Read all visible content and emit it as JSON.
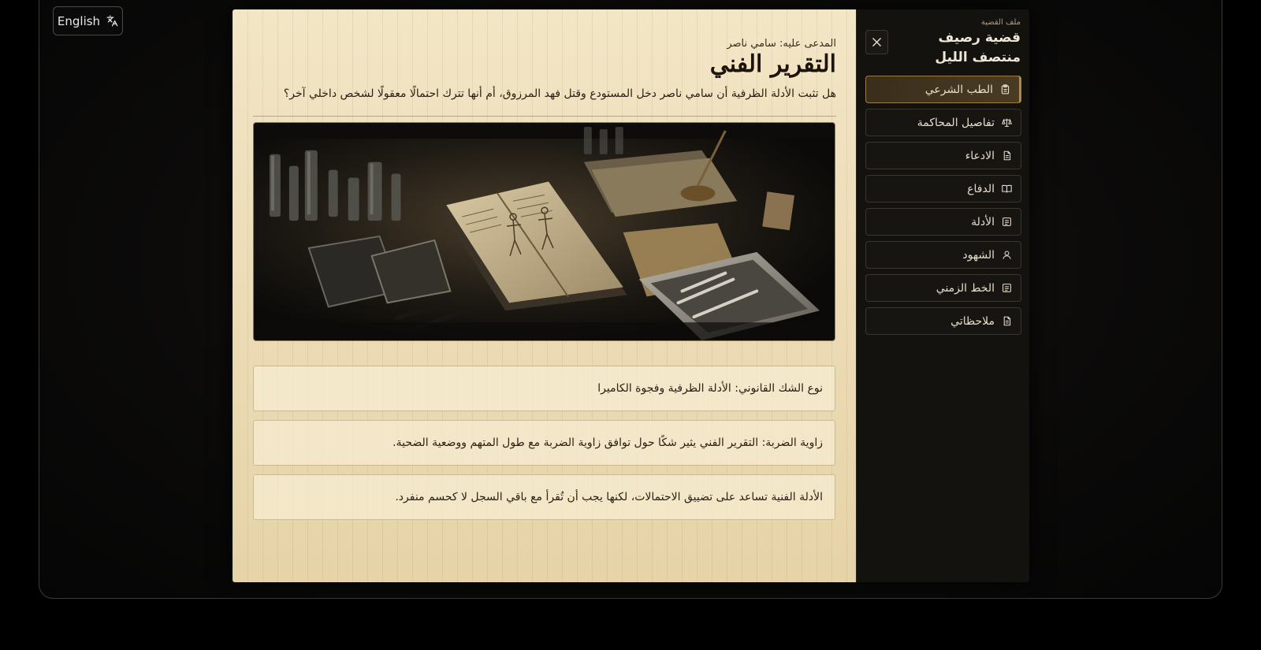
{
  "language_button": {
    "label": "English",
    "icon": "translate-icon"
  },
  "sidebar": {
    "case_label": "ملف القضية",
    "case_title": "قضية رصيف منتصف الليل",
    "close_icon": "close-icon",
    "items": [
      {
        "label": "الطب الشرعي",
        "icon": "clipboard-icon",
        "active": true
      },
      {
        "label": "تفاصيل المحاكمة",
        "icon": "scales-icon",
        "active": false
      },
      {
        "label": "الادعاء",
        "icon": "document-icon",
        "active": false
      },
      {
        "label": "الدفاع",
        "icon": "book-open-icon",
        "active": false
      },
      {
        "label": "الأدلة",
        "icon": "scroll-icon",
        "active": false
      },
      {
        "label": "الشهود",
        "icon": "user-icon",
        "active": false
      },
      {
        "label": "الخط الزمني",
        "icon": "scroll-icon",
        "active": false
      },
      {
        "label": "ملاحظاتي",
        "icon": "document-icon",
        "active": false
      }
    ]
  },
  "document": {
    "accused": "المدعى عليه: سامي ناصر",
    "title": "التقرير الفني",
    "question": "هل تثبت الأدلة الظرفية أن سامي ناصر دخل المستودع وقتل فهد المرزوق، أم أنها تترك احتمالًا معقولًا لشخص داخلي آخر؟",
    "notes": [
      "نوع الشك القانوني: الأدلة الظرفية وفجوة الكاميرا",
      "زاوية الضربة: التقرير الفني يثير شكًا حول توافق زاوية الضربة مع طول المتهم ووضعية الضحية.",
      "الأدلة الفنية تساعد على تضييق الاحتمالات، لكنها يجب أن تُقرأ مع باقي السجل لا كحسم منفرد."
    ]
  },
  "colors": {
    "paper": "#ecdcb6",
    "sidebar_bg": "#14120f",
    "accent": "#b08a4a"
  }
}
